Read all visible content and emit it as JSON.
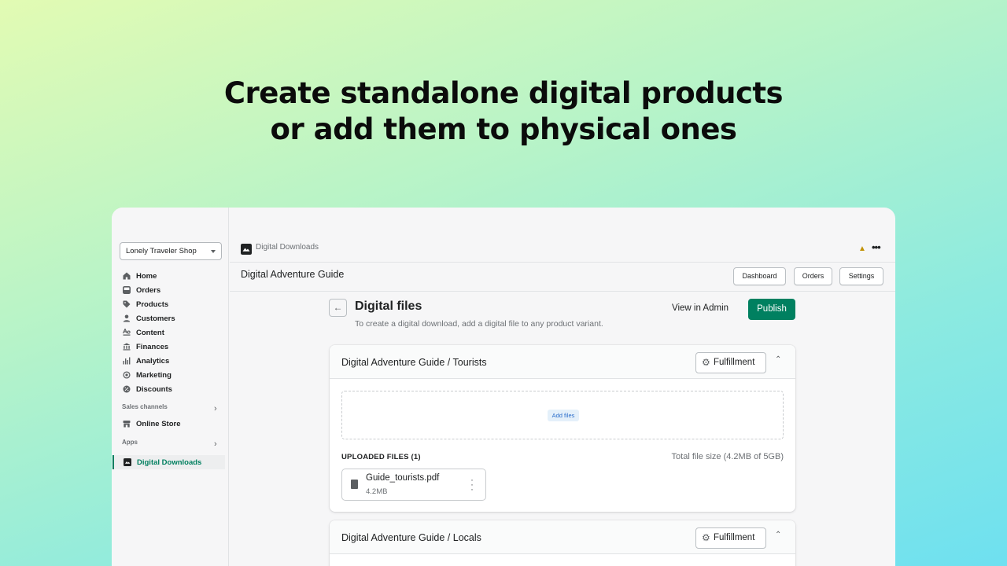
{
  "headline": {
    "line1": "Create standalone digital products",
    "line2": "or add them to physical ones"
  },
  "sidebar": {
    "store_name": "Lonely Traveler Shop",
    "items": [
      {
        "label": "Home",
        "icon": "home-icon"
      },
      {
        "label": "Orders",
        "icon": "orders-icon"
      },
      {
        "label": "Products",
        "icon": "tag-icon"
      },
      {
        "label": "Customers",
        "icon": "person-icon"
      },
      {
        "label": "Content",
        "icon": "content-icon"
      },
      {
        "label": "Finances",
        "icon": "bank-icon"
      },
      {
        "label": "Analytics",
        "icon": "bar-chart-icon"
      },
      {
        "label": "Marketing",
        "icon": "target-icon"
      },
      {
        "label": "Discounts",
        "icon": "discount-icon"
      }
    ],
    "sales_channels_label": "Sales channels",
    "online_store": "Online Store",
    "apps_label": "Apps",
    "active_app": "Digital Downloads"
  },
  "app_bar": {
    "app_name": "Digital Downloads"
  },
  "title_bar": {
    "page_name": "Digital Adventure Guide",
    "buttons": [
      "Dashboard",
      "Orders",
      "Settings"
    ]
  },
  "content": {
    "title": "Digital files",
    "subtitle": "To create a digital download, add a digital file to any product variant.",
    "view_admin": "View in Admin",
    "publish": "Publish"
  },
  "cards": [
    {
      "title": "Digital Adventure Guide / Tourists",
      "fulfillment": "Fulfillment",
      "add_files": "Add files",
      "uploaded_label": "UPLOADED FILES (1)",
      "total_size": "Total file size (4.2MB of 5GB)",
      "file_name": "Guide_tourists.pdf",
      "file_size": "4.2MB"
    },
    {
      "title": "Digital Adventure Guide / Locals",
      "fulfillment": "Fulfillment"
    }
  ],
  "colors": {
    "primary": "#008060",
    "active_nav": "#007f5f",
    "pin": "#c29205"
  }
}
